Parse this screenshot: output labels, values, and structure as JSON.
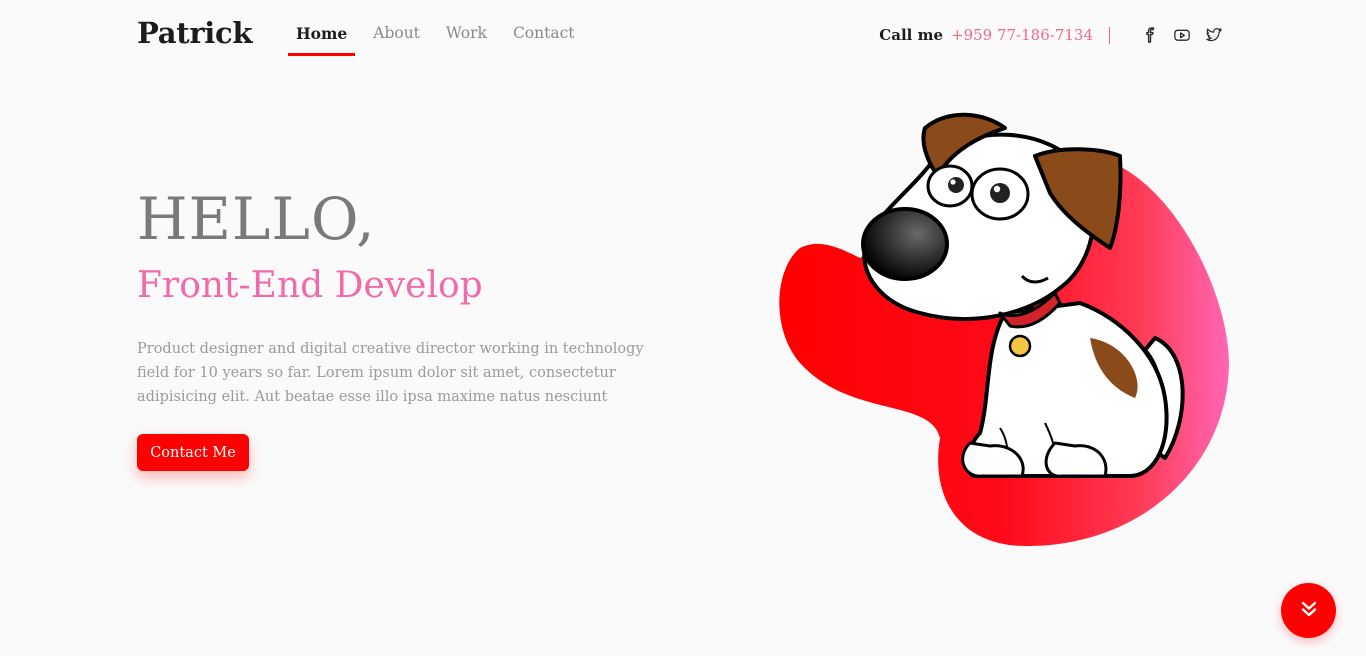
{
  "header": {
    "logo": "Patrick",
    "nav": [
      {
        "label": "Home",
        "active": true
      },
      {
        "label": "About",
        "active": false
      },
      {
        "label": "Work",
        "active": false
      },
      {
        "label": "Contact",
        "active": false
      }
    ],
    "call_label": "Call me",
    "phone": "+959 77-186-7134",
    "social_icons": [
      "facebook-icon",
      "youtube-icon",
      "twitter-icon"
    ]
  },
  "hero": {
    "greeting": "HELLO,",
    "role": "Front-End Develop",
    "description": "Product designer and digital creative director working in technology field for 10 years so far. Lorem ipsum dolor sit amet, consectetur adipisicing elit. Aut beatae esse illo ipsa maxime natus nesciunt",
    "cta_label": "Contact Me",
    "illustration": "cartoon-dog-illustration"
  },
  "scroll_button_icon": "double-chevron-down-icon",
  "colors": {
    "accent": "#ff0000",
    "pink": "#f36aaa",
    "phone": "#f36787",
    "background": "#fafafa",
    "text_dark": "#1c1c1c",
    "text_muted": "#9a9a9a"
  }
}
